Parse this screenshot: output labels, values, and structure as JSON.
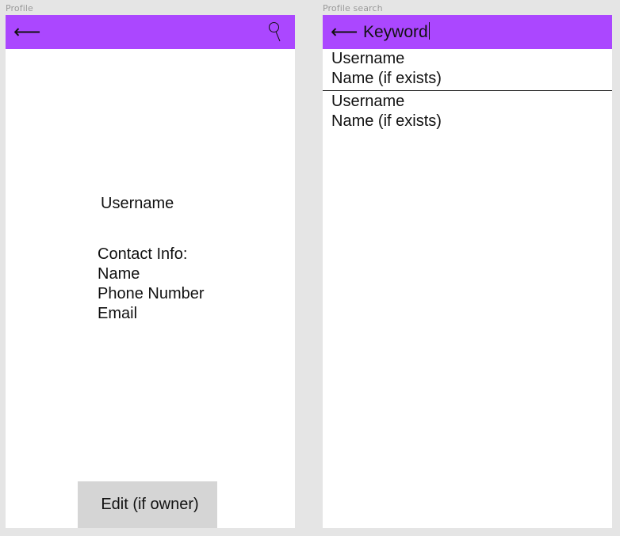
{
  "frames": {
    "profile": {
      "label": "Profile",
      "appbar": {
        "back_glyph": "⟵",
        "search_icon": "search-icon"
      },
      "username": "Username",
      "contact": {
        "heading": "Contact Info:",
        "name": "Name",
        "phone": "Phone Number",
        "email": "Email"
      },
      "edit_label": "Edit (if owner)"
    },
    "search": {
      "label": "Profile search",
      "appbar": {
        "back_glyph": "⟵",
        "keyword": "Keyword"
      },
      "results": [
        {
          "username": "Username",
          "name": "Name (if exists)"
        },
        {
          "username": "Username",
          "name": "Name (if exists)"
        }
      ]
    }
  },
  "colors": {
    "canvas": "#e5e5e5",
    "appbar": "#ab47ff",
    "edit_button": "#d5d5d5"
  }
}
